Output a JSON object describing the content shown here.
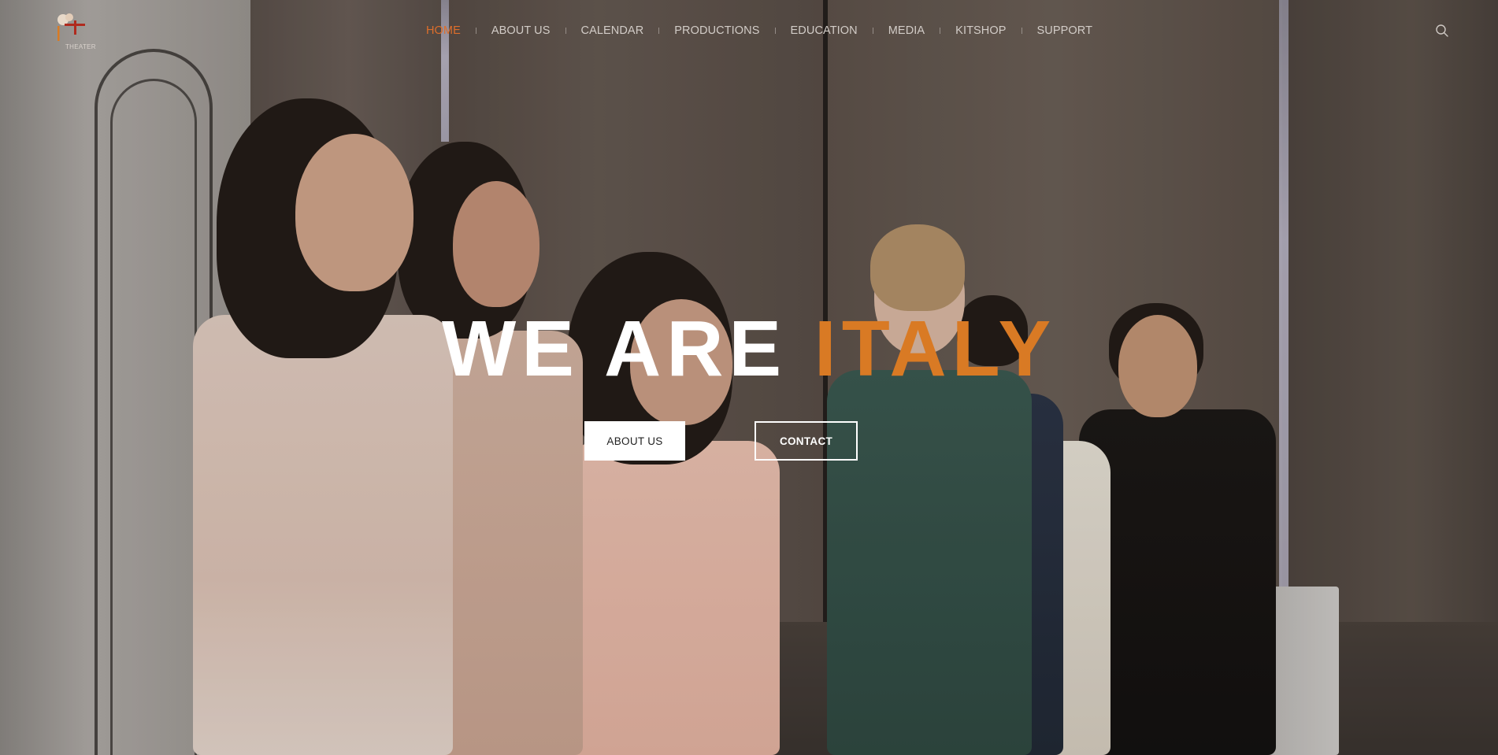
{
  "brand": {
    "logo_text": "KIT",
    "logo_subtext": "THEATER"
  },
  "nav": {
    "items": [
      {
        "label": "HOME",
        "active": true
      },
      {
        "label": "ABOUT US",
        "active": false
      },
      {
        "label": "CALENDAR",
        "active": false
      },
      {
        "label": "PRODUCTIONS",
        "active": false
      },
      {
        "label": "EDUCATION",
        "active": false
      },
      {
        "label": "MEDIA",
        "active": false
      },
      {
        "label": "KITSHOP",
        "active": false
      },
      {
        "label": "SUPPORT",
        "active": false
      }
    ],
    "search_icon": "search-icon"
  },
  "hero": {
    "headline_main": "WE ARE ",
    "headline_accent": "ITALY",
    "about_button": "ABOUT US",
    "contact_button": "CONTACT",
    "background": "stage photo of performers applauding"
  },
  "colors": {
    "accent": "#d97a24",
    "nav_active": "#de6e2b",
    "nav_text": "#d2ccc7",
    "headline": "#ffffff"
  }
}
